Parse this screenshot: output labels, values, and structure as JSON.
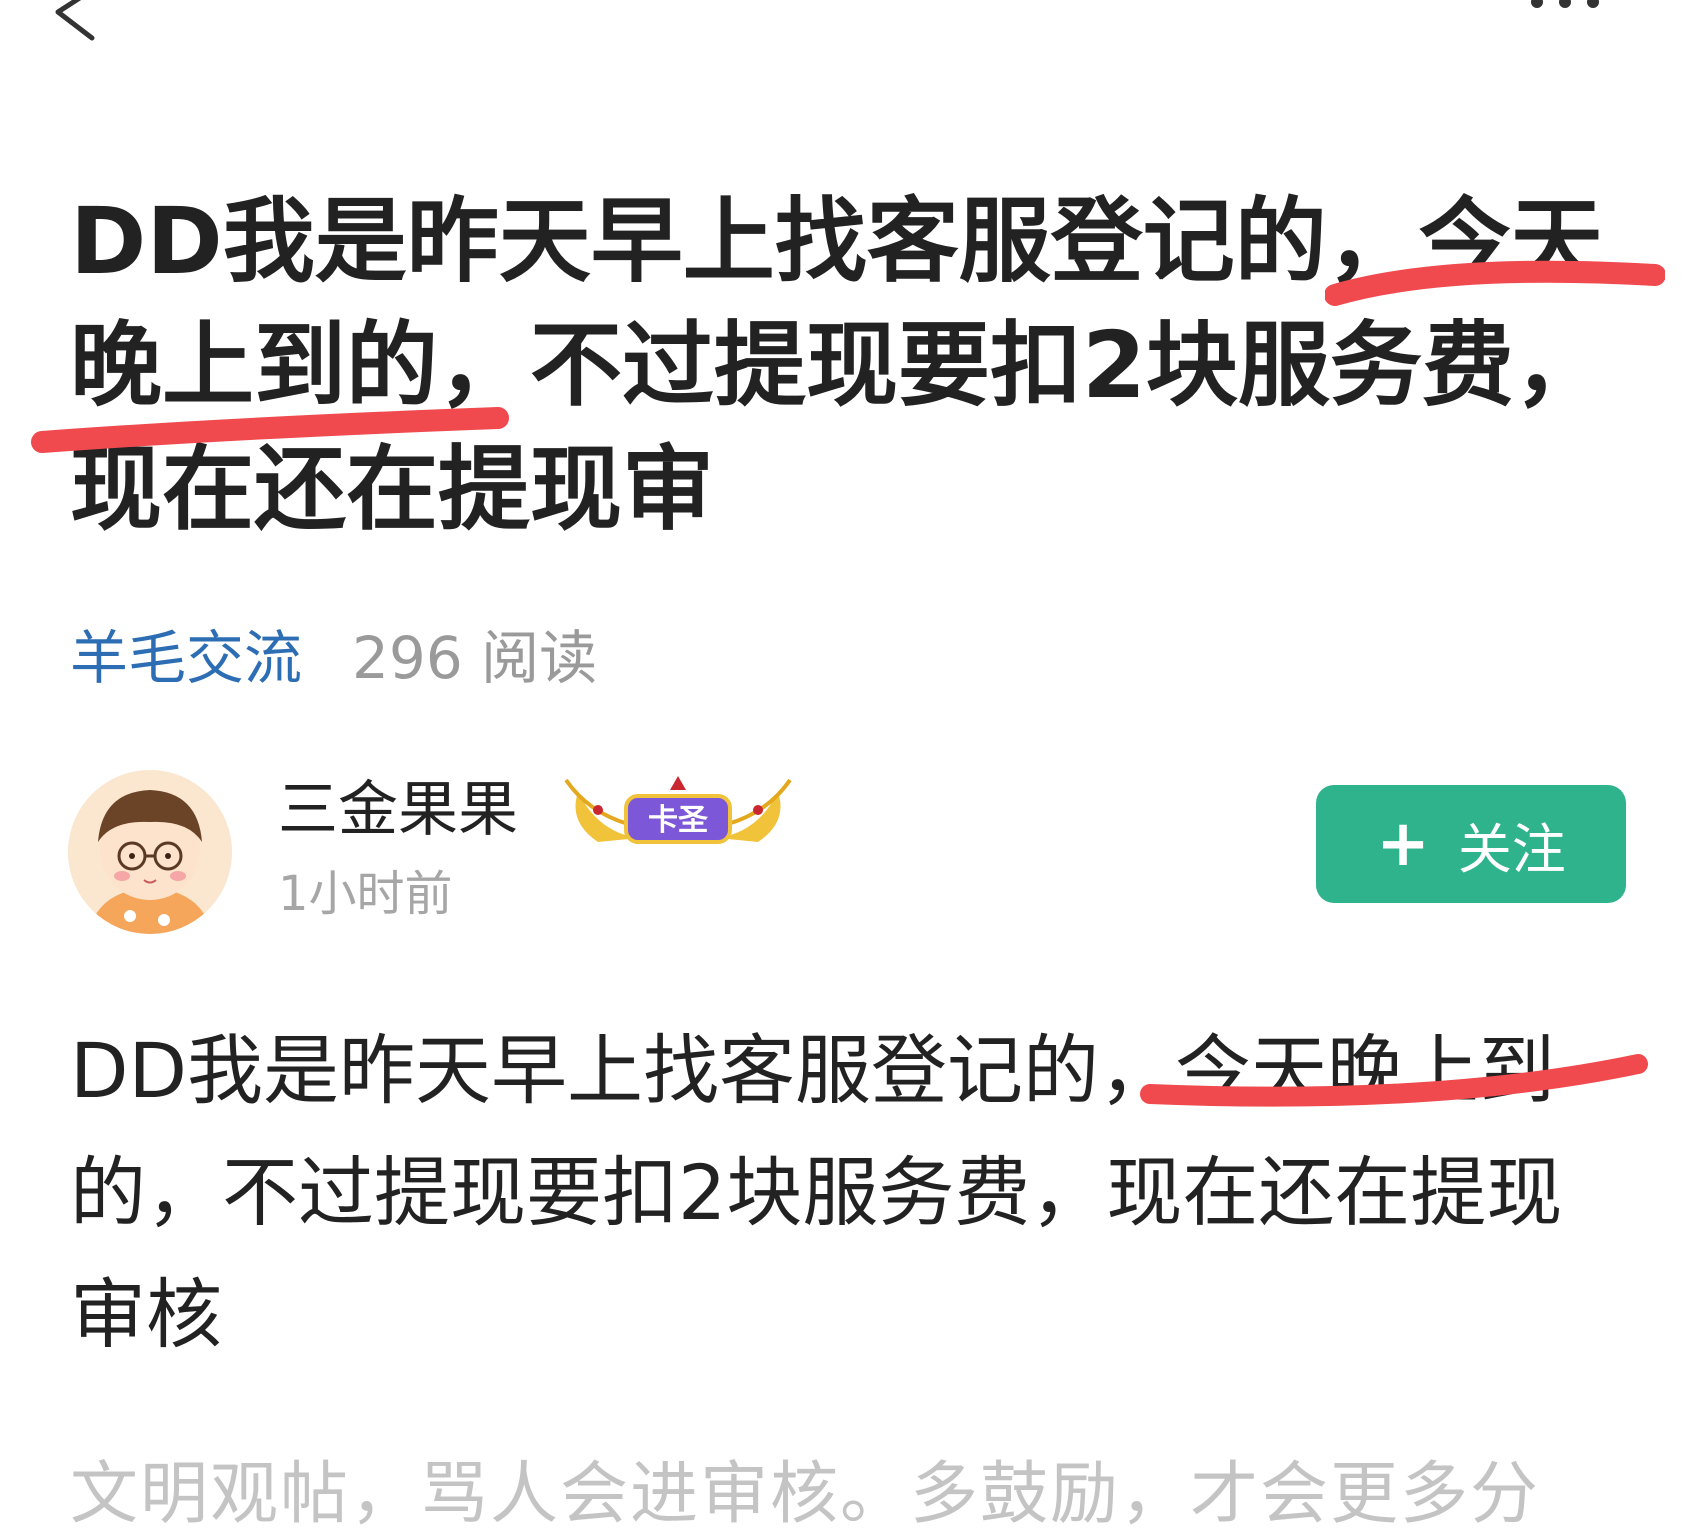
{
  "post": {
    "title": "DD我是昨天早上找客服登记的，今天晚上到的，不过提现要扣2块服务费，现在还在提现审",
    "category": "羊毛交流",
    "read_count": "296 阅读",
    "body": "DD我是昨天早上找客服登记的，今天晚上到的，不过提现要扣2块服务费，现在还在提现审核"
  },
  "author": {
    "name": "三金果果",
    "badge_label": "卡圣",
    "time": "1小时前",
    "follow_plus": "+",
    "follow_label": "关注"
  },
  "footer": {
    "tip": "文明观帖，骂人会进审核。多鼓励，才会更多分"
  },
  "icons": {
    "back": "chevron-left-icon",
    "more": "more-dots-icon"
  },
  "colors": {
    "category": "#2d6db4",
    "follow_button": "#2fb38c",
    "marker": "#f04a4f"
  }
}
